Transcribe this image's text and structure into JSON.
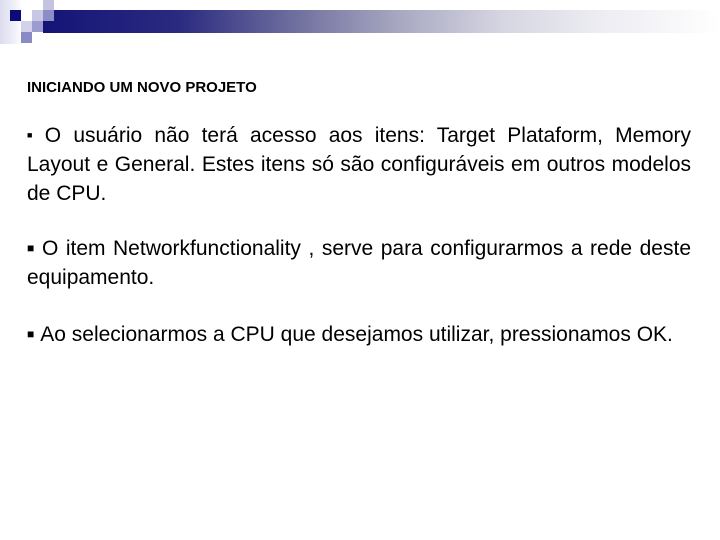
{
  "slide": {
    "title": "INICIANDO UM NOVO PROJETO",
    "bullets": [
      {
        "marker": "■",
        "text": "O usuário não terá acesso aos itens: Target Plataform, Memory Layout e General. Estes itens só são configuráveis em outros modelos de CPU."
      },
      {
        "marker": "■",
        "text": "O item Networkfunctionality , serve para configurarmos a rede deste equipamento."
      },
      {
        "marker": "■",
        "text": "Ao selecionarmos a CPU que desejamos utilizar, pressionamos OK."
      }
    ]
  },
  "theme": {
    "accent_dark": "#0c0c78",
    "accent_mid": "#8c8cc6",
    "accent_light": "#c8c8e4",
    "text_color": "#000000",
    "background": "#ffffff"
  }
}
